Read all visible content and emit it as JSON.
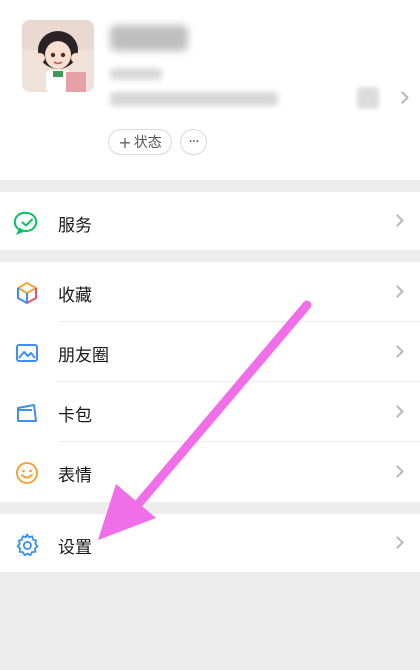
{
  "profile": {
    "status_label": "状态",
    "status_icon": "plus-icon",
    "more_label": "···"
  },
  "menu": {
    "group1": [
      {
        "label": "服务",
        "icon": "service-icon"
      }
    ],
    "group2": [
      {
        "label": "收藏",
        "icon": "favorites-icon"
      },
      {
        "label": "朋友圈",
        "icon": "moments-icon"
      },
      {
        "label": "卡包",
        "icon": "cards-icon"
      },
      {
        "label": "表情",
        "icon": "stickers-icon"
      }
    ],
    "group3": [
      {
        "label": "设置",
        "icon": "settings-icon"
      }
    ]
  },
  "colors": {
    "background": "#ededed",
    "panel": "#ffffff",
    "wechat_green": "#07c160",
    "arrow_magenta": "#f06ee8"
  }
}
